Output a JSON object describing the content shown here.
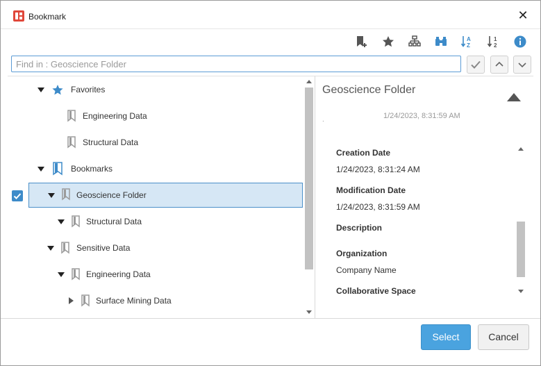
{
  "window": {
    "title": "Bookmark",
    "close_glyph": "✕"
  },
  "toolbar": {
    "icons": [
      "add-bookmark-icon",
      "star-icon",
      "hierarchy-icon",
      "binoculars-icon",
      "sort-alpha-icon",
      "sort-numeric-icon",
      "info-icon"
    ]
  },
  "search": {
    "value": "",
    "placeholder": "Find in : Geoscience Folder"
  },
  "tree": {
    "items": [
      {
        "label": "Favorites",
        "icon": "star-icon",
        "expanded": true
      },
      {
        "label": "Engineering Data",
        "icon": "bookmark-icon"
      },
      {
        "label": "Structural Data",
        "icon": "bookmark-icon"
      },
      {
        "label": "Bookmarks",
        "icon": "bookmark-icon",
        "expanded": true
      },
      {
        "label": "Geoscience Folder",
        "icon": "bookmark-icon",
        "expanded": true,
        "selected": true,
        "checked": true
      },
      {
        "label": "Structural Data",
        "icon": "bookmark-icon",
        "expanded": true
      },
      {
        "label": "Sensitive Data",
        "icon": "bookmark-icon",
        "expanded": true
      },
      {
        "label": "Engineering Data",
        "icon": "bookmark-icon",
        "expanded": true
      },
      {
        "label": "Surface Mining Data",
        "icon": "bookmark-icon",
        "expanded": false
      }
    ]
  },
  "details": {
    "title": "Geoscience Folder",
    "dot": ".",
    "date": "1/24/2023, 8:31:59 AM",
    "fields": [
      {
        "label": "Creation Date",
        "value": "1/24/2023, 8:31:24 AM"
      },
      {
        "label": "Modification Date",
        "value": "1/24/2023, 8:31:59 AM"
      },
      {
        "label": "Description",
        "value": ""
      },
      {
        "label": "Organization",
        "value": "Company Name"
      },
      {
        "label": "Collaborative Space",
        "value": ""
      }
    ]
  },
  "footer": {
    "select_label": "Select",
    "cancel_label": "Cancel"
  },
  "colors": {
    "accent": "#4aa3df",
    "selection": "#d6e7f5",
    "icon_blue": "#3d8bc9",
    "icon_gray": "#9b9b9b"
  }
}
